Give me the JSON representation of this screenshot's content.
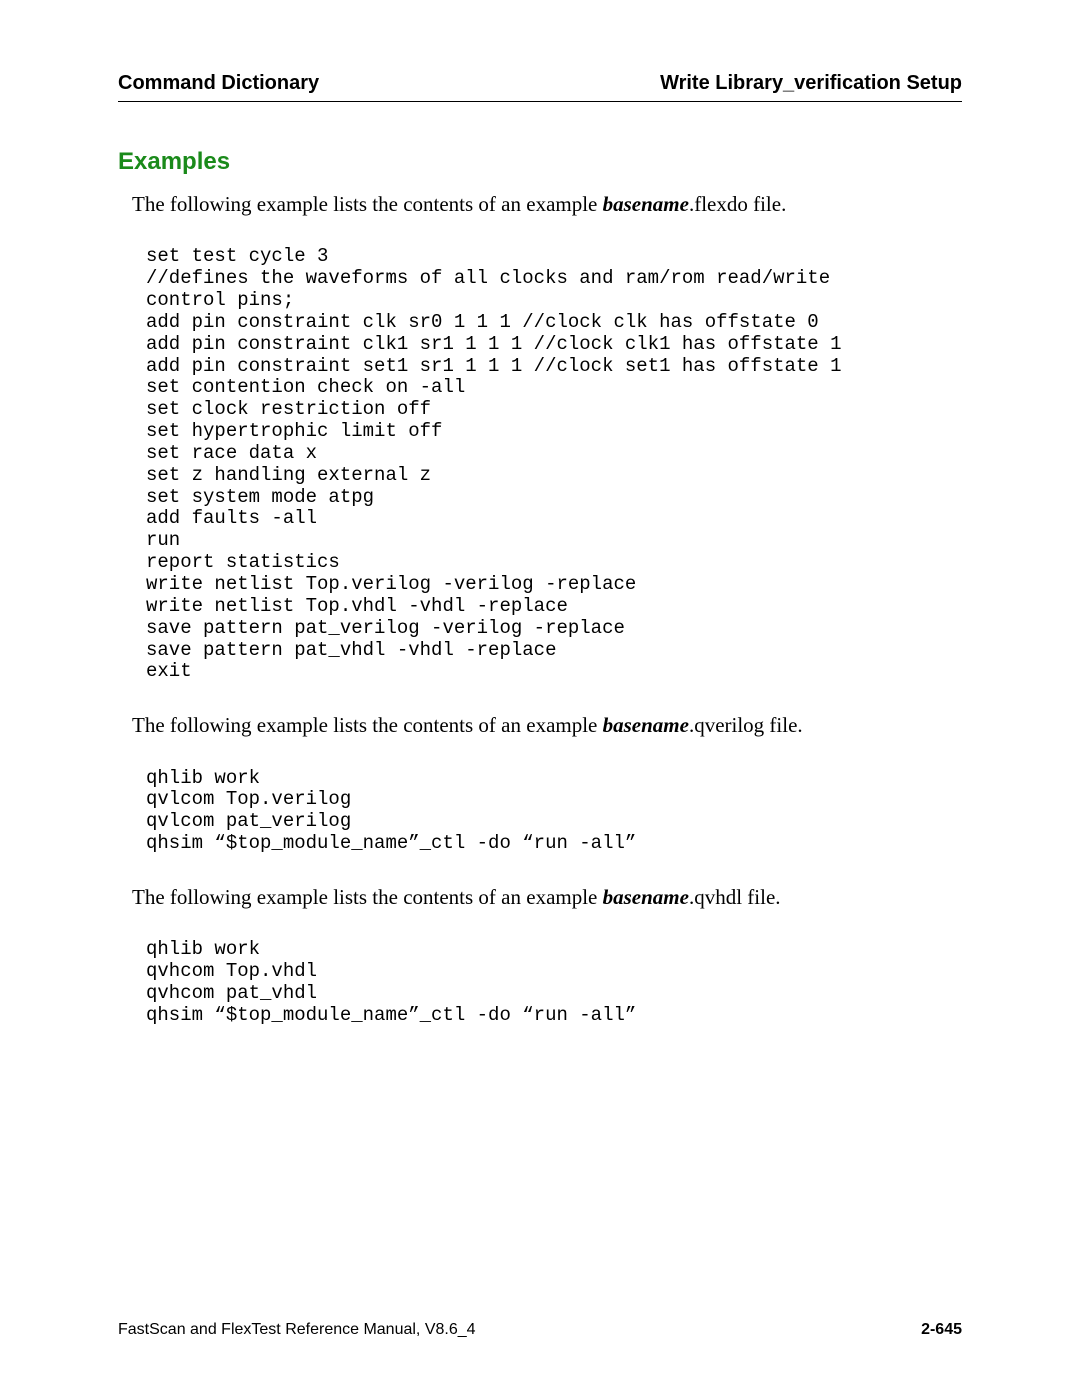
{
  "header": {
    "left": "Command Dictionary",
    "right": "Write Library_verification Setup"
  },
  "section_title": "Examples",
  "blocks": [
    {
      "intro_pre": "The following example lists the contents of an example ",
      "intro_basename": "basename",
      "intro_post": ".flexdo file.",
      "code": "set test cycle 3\n//defines the waveforms of all clocks and ram/rom read/write\ncontrol pins;\nadd pin constraint clk sr0 1 1 1 //clock clk has offstate 0\nadd pin constraint clk1 sr1 1 1 1 //clock clk1 has offstate 1\nadd pin constraint set1 sr1 1 1 1 //clock set1 has offstate 1\nset contention check on -all\nset clock restriction off\nset hypertrophic limit off\nset race data x\nset z handling external z\nset system mode atpg\nadd faults -all\nrun\nreport statistics\nwrite netlist Top.verilog -verilog -replace\nwrite netlist Top.vhdl -vhdl -replace\nsave pattern pat_verilog -verilog -replace\nsave pattern pat_vhdl -vhdl -replace\nexit"
    },
    {
      "intro_pre": "The following example lists the contents of an example ",
      "intro_basename": "basename",
      "intro_post": ".qverilog file.",
      "code": "qhlib work\nqvlcom Top.verilog\nqvlcom pat_verilog\nqhsim “$top_module_name”_ctl -do “run -all”"
    },
    {
      "intro_pre": "The following example lists the contents of an example ",
      "intro_basename": "basename",
      "intro_post": ".qvhdl file.",
      "code": "qhlib work\nqvhcom Top.vhdl\nqvhcom pat_vhdl\nqhsim “$top_module_name”_ctl -do “run -all”"
    }
  ],
  "footer": {
    "left": "FastScan and FlexTest Reference Manual, V8.6_4",
    "right": "2-645"
  }
}
